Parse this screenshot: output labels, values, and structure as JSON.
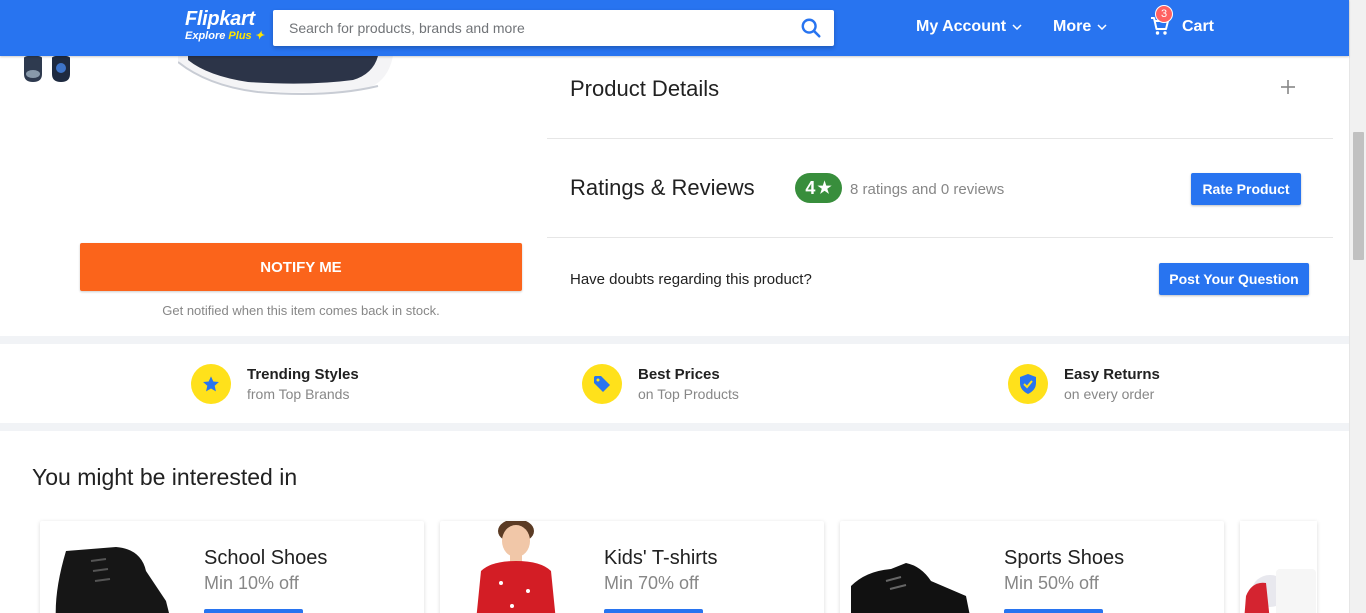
{
  "header": {
    "logo_text": "Flipkart",
    "logo_sub": "Explore",
    "logo_plus": "Plus",
    "search_placeholder": "Search for products, brands and more",
    "account_label": "My Account",
    "more_label": "More",
    "cart_label": "Cart",
    "cart_count": "3"
  },
  "product": {
    "notify_label": "NOTIFY ME",
    "notify_note": "Get notified when this item comes back in stock.",
    "details_title": "Product Details",
    "ratings_title": "Ratings & Reviews",
    "rating_value": "4",
    "rating_count": "8 ratings and 0 reviews",
    "rate_button": "Rate Product",
    "doubts_text": "Have doubts regarding this product?",
    "question_button": "Post Your Question"
  },
  "features": [
    {
      "title": "Trending Styles",
      "subtitle": "from Top Brands",
      "icon": "star-icon"
    },
    {
      "title": "Best Prices",
      "subtitle": "on Top Products",
      "icon": "price-tag-icon"
    },
    {
      "title": "Easy Returns",
      "subtitle": "on every order",
      "icon": "shield-check-icon"
    }
  ],
  "recommendations": {
    "title": "You might be interested in",
    "items": [
      {
        "name": "School Shoes",
        "offer": "Min 10% off"
      },
      {
        "name": "Kids' T-shirts",
        "offer": "Min 70% off"
      },
      {
        "name": "Sports Shoes",
        "offer": "Min 50% off"
      }
    ]
  },
  "colors": {
    "brand_blue": "#2874f0",
    "notify_orange": "#fb641b",
    "rating_green": "#388e3c",
    "feature_yellow": "#ffe11b",
    "plus_yellow": "#ffe500"
  }
}
